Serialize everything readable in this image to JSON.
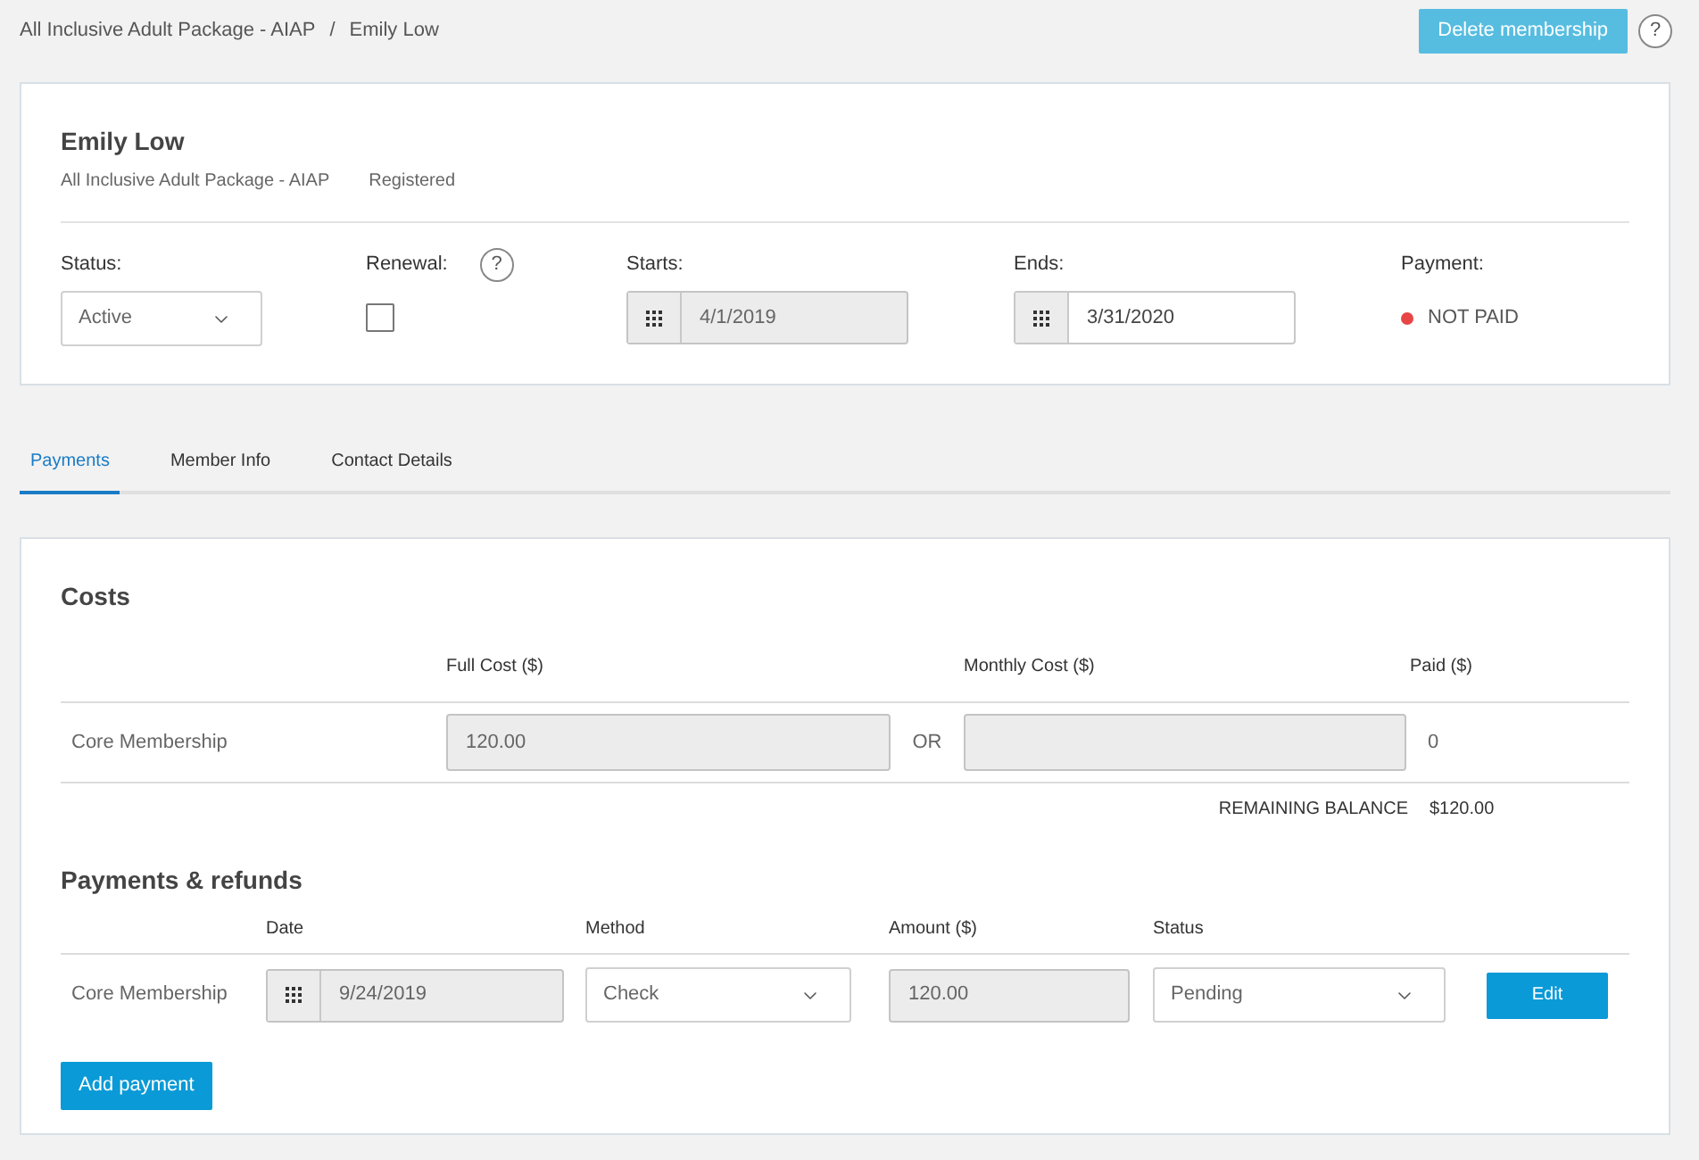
{
  "breadcrumb": {
    "items": [
      "All Inclusive Adult Package - AIAP",
      "Emily Low"
    ],
    "separator": "/"
  },
  "header_actions": {
    "delete_button": "Delete membership",
    "help": "?"
  },
  "member": {
    "name": "Emily Low",
    "package": "All Inclusive Adult Package - AIAP",
    "registration": "Registered"
  },
  "fields": [
    {
      "kind": "select",
      "label": "Status:",
      "value": "Active"
    },
    {
      "kind": "checkbox",
      "label": "Renewal:",
      "help": "?",
      "checked": false
    },
    {
      "kind": "date",
      "label": "Starts:",
      "value": "4/1/2019",
      "disabled": true
    },
    {
      "kind": "date",
      "label": "Ends:",
      "value": "3/31/2020",
      "disabled": false
    },
    {
      "kind": "status",
      "label": "Payment:",
      "value": "NOT PAID",
      "color": "#e84545"
    }
  ],
  "tabs": [
    {
      "label": "Payments",
      "selected": true
    },
    {
      "label": "Member Info",
      "selected": false
    },
    {
      "label": "Contact Details",
      "selected": false
    }
  ],
  "costs": {
    "title": "Costs",
    "columns": [
      "Full Cost ($)",
      "Monthly Cost ($)",
      "Paid ($)"
    ],
    "rows": [
      {
        "name": "Core Membership",
        "full_cost": {
          "value": "120.00",
          "disabled": true
        },
        "separator": "OR",
        "monthly_cost": {
          "disabled": true
        },
        "paid": "0"
      }
    ],
    "remaining": {
      "label": "REMAINING BALANCE",
      "value": "$120.00"
    }
  },
  "payments": {
    "title": "Payments & refunds",
    "columns": [
      "Date",
      "Method",
      "Amount ($)",
      "Status"
    ],
    "rows": [
      {
        "name": "Core Membership",
        "date": {
          "value": "9/24/2019",
          "disabled": true
        },
        "method": "Check",
        "amount": {
          "value": "120.00",
          "disabled": true
        },
        "status": "Pending",
        "action": "Edit"
      }
    ],
    "add_button": "Add payment"
  }
}
